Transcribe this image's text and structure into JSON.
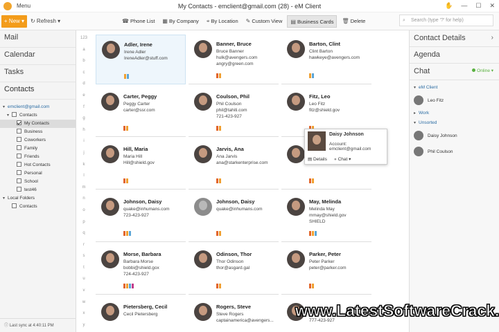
{
  "window": {
    "title": "My Contacts - emclient@gmail.com (28) - eM Client",
    "menu": "Menu"
  },
  "toolbar": {
    "new_label": "+ New ▾",
    "refresh_label": "↻ Refresh ▾",
    "views": [
      {
        "icon": "phone-list-icon",
        "label": "Phone List"
      },
      {
        "icon": "building-icon",
        "label": "By Company"
      },
      {
        "icon": "location-pin-icon",
        "label": "By Location"
      },
      {
        "icon": "wrench-icon",
        "label": "Custom View"
      },
      {
        "icon": "business-cards-icon",
        "label": "Business Cards"
      },
      {
        "icon": "trash-icon",
        "label": "Delete"
      }
    ],
    "search_placeholder": "Search (type '?' for help)"
  },
  "sidebar": {
    "mail": "Mail",
    "calendar": "Calendar",
    "tasks": "Tasks",
    "contacts": "Contacts",
    "account": "emclient@gmail.com",
    "contacts_folder": "Contacts",
    "folders": [
      "My Contacts",
      "Business",
      "Coworkers",
      "Family",
      "Friends",
      "Hot Contacts",
      "Personal",
      "School",
      "test46"
    ],
    "local_folders": "Local Folders",
    "local_contacts": "Contacts",
    "status": "Last sync at 4:40:11 PM"
  },
  "alphabet": [
    "123",
    "a",
    "b",
    "c",
    "d",
    "e",
    "f",
    "g",
    "h",
    "i",
    "j",
    "k",
    "l",
    "m",
    "n",
    "o",
    "p",
    "q",
    "r",
    "s",
    "t",
    "u",
    "v",
    "w",
    "x",
    "y"
  ],
  "cards": [
    {
      "name": "Adler, Irene",
      "lines": [
        "Irene Adler",
        "IreneAdler@stuff.com"
      ],
      "tags": [
        "#f0a030",
        "#5aa6d8"
      ]
    },
    {
      "name": "Banner, Bruce",
      "lines": [
        "Bruce Banner",
        "hulk@avengers.com",
        "angry@green.com"
      ],
      "tags": [
        "#e2652b",
        "#f0a030"
      ]
    },
    {
      "name": "Barton, Clint",
      "lines": [
        "Clint Barton",
        "hawkeye@avengers.com"
      ],
      "tags": [
        "#f0a030",
        "#5aa6d8"
      ]
    },
    {
      "name": "Carter, Peggy",
      "lines": [
        "Peggy Carter",
        "carter@ssr.com"
      ],
      "tags": [
        "#e2652b",
        "#f0a030"
      ]
    },
    {
      "name": "Coulson, Phil",
      "lines": [
        "Phil Coulson",
        "phil@tahiti.com",
        "721-423-927"
      ],
      "tags": [
        "#e2652b",
        "#f0a030"
      ]
    },
    {
      "name": "Fitz, Leo",
      "lines": [
        "Leo Fitz",
        "fitz@shield.gov"
      ],
      "tags": [
        "#e2652b",
        "#f0a030"
      ]
    },
    {
      "name": "Hill, Maria",
      "lines": [
        "Maria Hill",
        "Hill@shield.gov"
      ],
      "tags": [
        "#e2652b",
        "#f0a030"
      ]
    },
    {
      "name": "Jarvis, Ana",
      "lines": [
        "Ana Jarvis",
        "ana@starkenterprise.com"
      ],
      "tags": [
        "#e2652b",
        "#f0a030"
      ]
    },
    {
      "name": "",
      "lines": [],
      "tags": [
        "#e2652b",
        "#f0a030"
      ]
    },
    {
      "name": "Johnson, Daisy",
      "lines": [
        "quake@inhumans.com",
        "723-423-927"
      ],
      "tags": [
        "#e2652b",
        "#f0a030",
        "#5aa6d8"
      ]
    },
    {
      "name": "Johnson, Daisy",
      "lines": [
        "quake@inhumans.com"
      ],
      "tags": [
        "#e2652b",
        "#f0a030"
      ]
    },
    {
      "name": "May, Melinda",
      "lines": [
        "Melinda May",
        "mmay@shield.gov",
        "SHIELD"
      ],
      "tags": [
        "#e2652b",
        "#f0a030",
        "#5aa6d8"
      ]
    },
    {
      "name": "Morse, Barbara",
      "lines": [
        "Barbara Morse",
        "bobbi@shield.gox",
        "724-423-927"
      ],
      "tags": [
        "#e2652b",
        "#f0a030",
        "#5aa6d8",
        "#c23b8a"
      ]
    },
    {
      "name": "Odinson, Thor",
      "lines": [
        "Thor Odinson",
        "thor@asgard.gal"
      ],
      "tags": [
        "#e2652b",
        "#f0a030"
      ]
    },
    {
      "name": "Parker, Peter",
      "lines": [
        "Peter Parker",
        "peter@parker.com"
      ],
      "tags": [
        "#e2652b",
        "#f0a030"
      ]
    },
    {
      "name": "Pietersberg, Cecil",
      "lines": [
        "Cecil Pietersberg"
      ],
      "tags": []
    },
    {
      "name": "Rogers, Steve",
      "lines": [
        "Steve Rogers",
        "captainamerica@avengers..."
      ],
      "tags": []
    },
    {
      "name": "",
      "lines": [
        "blackwidow@avengers.com",
        "777-423-927"
      ],
      "tags": []
    }
  ],
  "popup": {
    "name": "Daisy Johnson",
    "account": "Account: emclient@gmail.com",
    "details": "Details",
    "chat": "Chat ▾"
  },
  "right": {
    "contact_details": "Contact Details",
    "agenda": "Agenda",
    "chat": "Chat",
    "online": "Online ▾",
    "groups": [
      {
        "label": "eM Client",
        "buddies": [
          "Leo Fitz"
        ]
      },
      {
        "label": "Work",
        "buddies": []
      },
      {
        "label": "Unsorted",
        "buddies": [
          "Daisy Johnson",
          "Phil Coulson"
        ]
      }
    ]
  },
  "watermark": "www.LatestSoftwareCrack.com"
}
